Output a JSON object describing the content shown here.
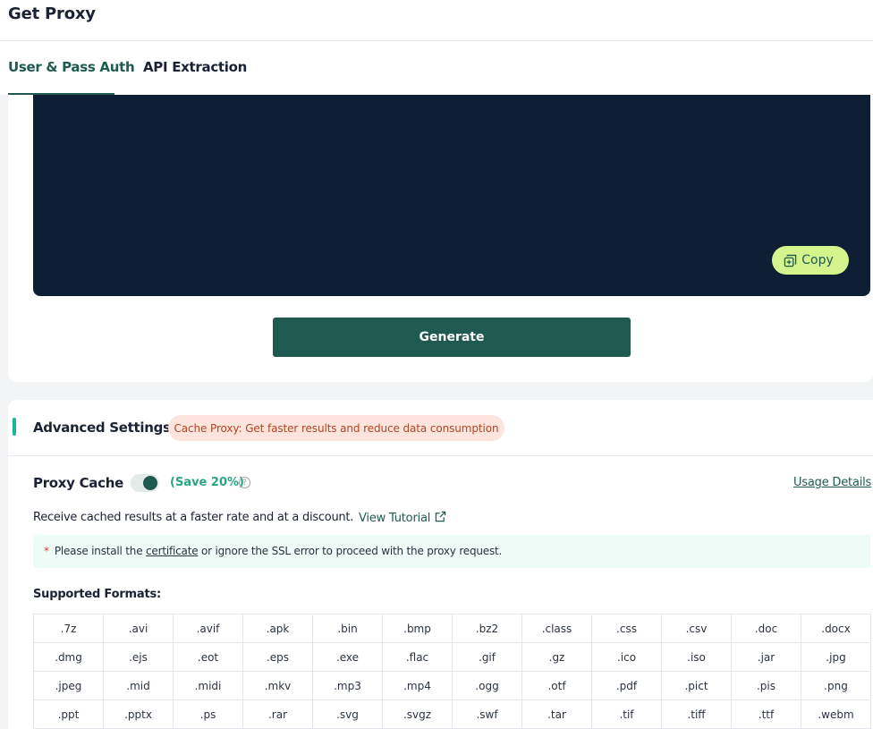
{
  "header": {
    "title": "Get Proxy"
  },
  "tabs": [
    {
      "label": "User & Pass Auth",
      "active": true
    },
    {
      "label": "API Extraction",
      "active": false
    }
  ],
  "code_panel": {
    "copy_label": "Copy"
  },
  "generate": {
    "label": "Generate"
  },
  "advanced": {
    "title": "Advanced Settings",
    "cache_badge": "Cache Proxy: Get faster results and reduce data consumption"
  },
  "proxy_cache": {
    "label": "Proxy Cache",
    "enabled": true,
    "save_text": "(Save 20%)",
    "help_glyph": "?",
    "usage_link": "Usage Details",
    "description": "Receive cached results at a faster rate and at a discount.",
    "tutorial_link": "View Tutorial"
  },
  "notice": {
    "star": "*",
    "prefix": "Please install the",
    "link": "certificate",
    "suffix": "or ignore the SSL error to proceed with the proxy request."
  },
  "formats": {
    "label": "Supported Formats:",
    "items": [
      ".7z",
      ".avi",
      ".avif",
      ".apk",
      ".bin",
      ".bmp",
      ".bz2",
      ".class",
      ".css",
      ".csv",
      ".doc",
      ".docx",
      ".dmg",
      ".ejs",
      ".eot",
      ".eps",
      ".exe",
      ".flac",
      ".gif",
      ".gz",
      ".ico",
      ".iso",
      ".jar",
      ".jpg",
      ".jpeg",
      ".mid",
      ".midi",
      ".mkv",
      ".mp3",
      ".mp4",
      ".ogg",
      ".otf",
      ".pdf",
      ".pict",
      ".pis",
      ".png",
      ".ppt",
      ".pptx",
      ".ps",
      ".rar",
      ".svg",
      ".svgz",
      ".swf",
      ".tar",
      ".tif",
      ".tiff",
      ".ttf",
      ".webm"
    ]
  },
  "colors": {
    "brand": "#1f5a50",
    "code_bg": "#0d1e35",
    "copy_bg": "#d4f58e",
    "accent": "#1db69a",
    "badge_bg": "#fde4dc",
    "badge_text": "#b24427",
    "notice_bg": "#edfcf6"
  }
}
